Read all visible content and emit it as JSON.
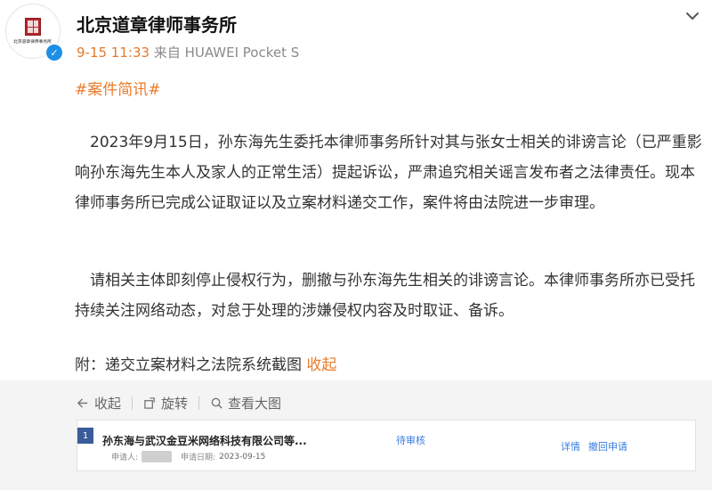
{
  "post": {
    "author": "北京道章律师事务所",
    "avatar_text": "北京道章律师事务所",
    "time": "9-15 11:33",
    "source": "来自 HUAWEI Pocket S",
    "hashtag": "#案件简讯#",
    "paragraphs": [
      "2023年9月15日，孙东海先生委托本律师事务所针对其与张女士相关的诽谤言论（已严重影响孙东海先生本人及家人的正常生活）提起诉讼，严肃追究相关谣言发布者之法律责任。现本律师事务所已完成公证取证以及立案材料递交工作，案件将由法院进一步审理。",
      "请相关主体即刻停止侵权行为，删撤与孙东海先生相关的诽谤言论。本律师事务所亦已受托持续关注网络动态，对怠于处理的涉嫌侵权内容及时取证、备诉。"
    ],
    "attachment_note": "附：递交立案材料之法院系统截图",
    "collapse_label": "收起"
  },
  "toolbar": {
    "collapse": "收起",
    "rotate": "旋转",
    "view_large": "查看大图"
  },
  "case_record": {
    "index": "1",
    "title": "孙东海与武汉金豆米网络科技有限公司等...",
    "status": "待审核",
    "applicant_label": "申请人:",
    "date_label": "申请日期:",
    "date": "2023-09-15",
    "detail_label": "详情",
    "withdraw_label": "撤回申请"
  },
  "colors": {
    "accent_orange": "#eb7b2a",
    "verified_blue": "#1e8fe6",
    "link_blue": "#3a7de0"
  }
}
